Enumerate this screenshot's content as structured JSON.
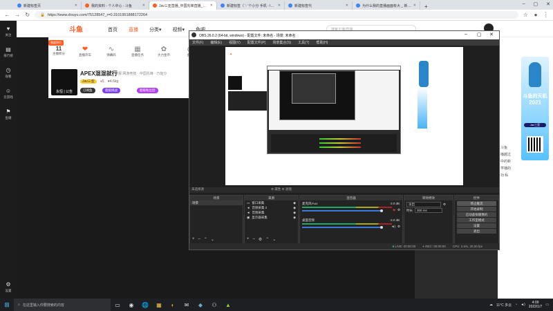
{
  "browser": {
    "tabs": [
      {
        "label": "新建标签页",
        "active": false
      },
      {
        "label": "我的资料 - 个人中心 - 斗鱼",
        "active": false
      },
      {
        "label": "Jav三亚直播_中国先锋直播_斗鱼",
        "active": true
      },
      {
        "label": "新建标签（ '- '个小分 手机 - lutv...",
        "active": false
      },
      {
        "label": "新建标签代",
        "active": false
      },
      {
        "label": "为什么我的直播画面有大 _ 新建标签",
        "active": false
      }
    ],
    "url": "https://www.douyu.com/75128547_r=0.3101951888172264",
    "window_controls": [
      "–",
      "▢",
      "✕"
    ]
  },
  "site": {
    "logo": "斗鱼",
    "nav": [
      "首页",
      "直播",
      "分类▾",
      "视频▾",
      "鱼吧"
    ],
    "nav_active_index": 1,
    "search_placeholder": "搜索主播/直播",
    "left_nav": [
      {
        "icon": "♥",
        "label": "关注"
      },
      {
        "icon": "▤",
        "label": "排行榜"
      },
      {
        "icon": "◷",
        "label": "观看"
      },
      {
        "icon": "☺",
        "label": "云游戏"
      },
      {
        "icon": "⚑",
        "label": "鱼塘"
      },
      {
        "icon": "⚙",
        "label": "设置"
      }
    ],
    "room_tag": "热度排行",
    "categories": [
      {
        "icon": "11",
        "label": "主播积分"
      },
      {
        "icon": "❤",
        "label": "直播开车"
      },
      {
        "icon": "∿",
        "label": "弹幕码"
      },
      {
        "icon": "▦",
        "label": "直播任务"
      },
      {
        "icon": "✿",
        "label": "大力金币"
      },
      {
        "icon": "◍",
        "label": "金币"
      }
    ],
    "room_title": "APEX混混就行",
    "room_meta": "举报 网游竞技 · 中国先锋 · 万能分",
    "streamer_id": "Jav三亚",
    "streamer_level": "5",
    "streamer_fans": "4.6kg",
    "avatar_caption": "永恒 | 公告",
    "pills": [
      "订阅鱼",
      "超级挑战",
      "超级粉丝团"
    ],
    "right_texts": [
      "斗鱼",
      "播越过",
      "中的新",
      "学播的",
      "功 私"
    ],
    "promo_big": "斗鱼的天机",
    "promo_year": "2021",
    "promo_caption": "Jav三亚"
  },
  "obs": {
    "title": "OBS 26.0.2 (64-bit, windows) - 配置文件: 未命名 - 场景: 未命名",
    "menu": [
      "文件(F)",
      "编辑(E)",
      "视图(V)",
      "配置文件(P)",
      "场景集合(S)",
      "工具(T)",
      "帮助(H)"
    ],
    "scene_label": "未选择源",
    "scene_opts": "⚙ 属性  ⚙ 滤镜",
    "docks": {
      "scenes": {
        "title": "场景",
        "items": [
          "场景"
        ]
      },
      "sources": {
        "title": "来源",
        "items": [
          "窗口采集",
          "音频采集 2",
          "音频采集",
          "显示器采集"
        ]
      },
      "mixer": {
        "title": "混音器",
        "channels": [
          {
            "name": "麦克风/Aux",
            "db": "0.0 dB"
          },
          {
            "name": "桌面音频",
            "db": "0.0 dB"
          }
        ]
      },
      "transitions": {
        "title": "转场特效",
        "type": "淡出",
        "duration_label": "时长",
        "duration": "300 ms"
      },
      "controls": {
        "title": "控件",
        "buttons": [
          "停止推流",
          "开始录制",
          "启动虚拟摄像机",
          "工作室模式",
          "设置",
          "退出"
        ]
      }
    },
    "status": [
      "LIVE: 00:00:00",
      "REC: 00:00:00",
      "CPU: 2.5%, 30.00 fps"
    ]
  },
  "taskbar": {
    "search_placeholder": "在这里输入你要搜索的内容",
    "weather": "11°C 多云",
    "time": "4:09",
    "date": "2022/1/7",
    "apps": [
      "▭",
      "◉",
      "🌐",
      "▦",
      "◐",
      "✉",
      "◆",
      "⚇",
      "▲"
    ]
  },
  "colors": {
    "accent": "#ff5d23",
    "obs_bg": "#2b2b2b"
  }
}
